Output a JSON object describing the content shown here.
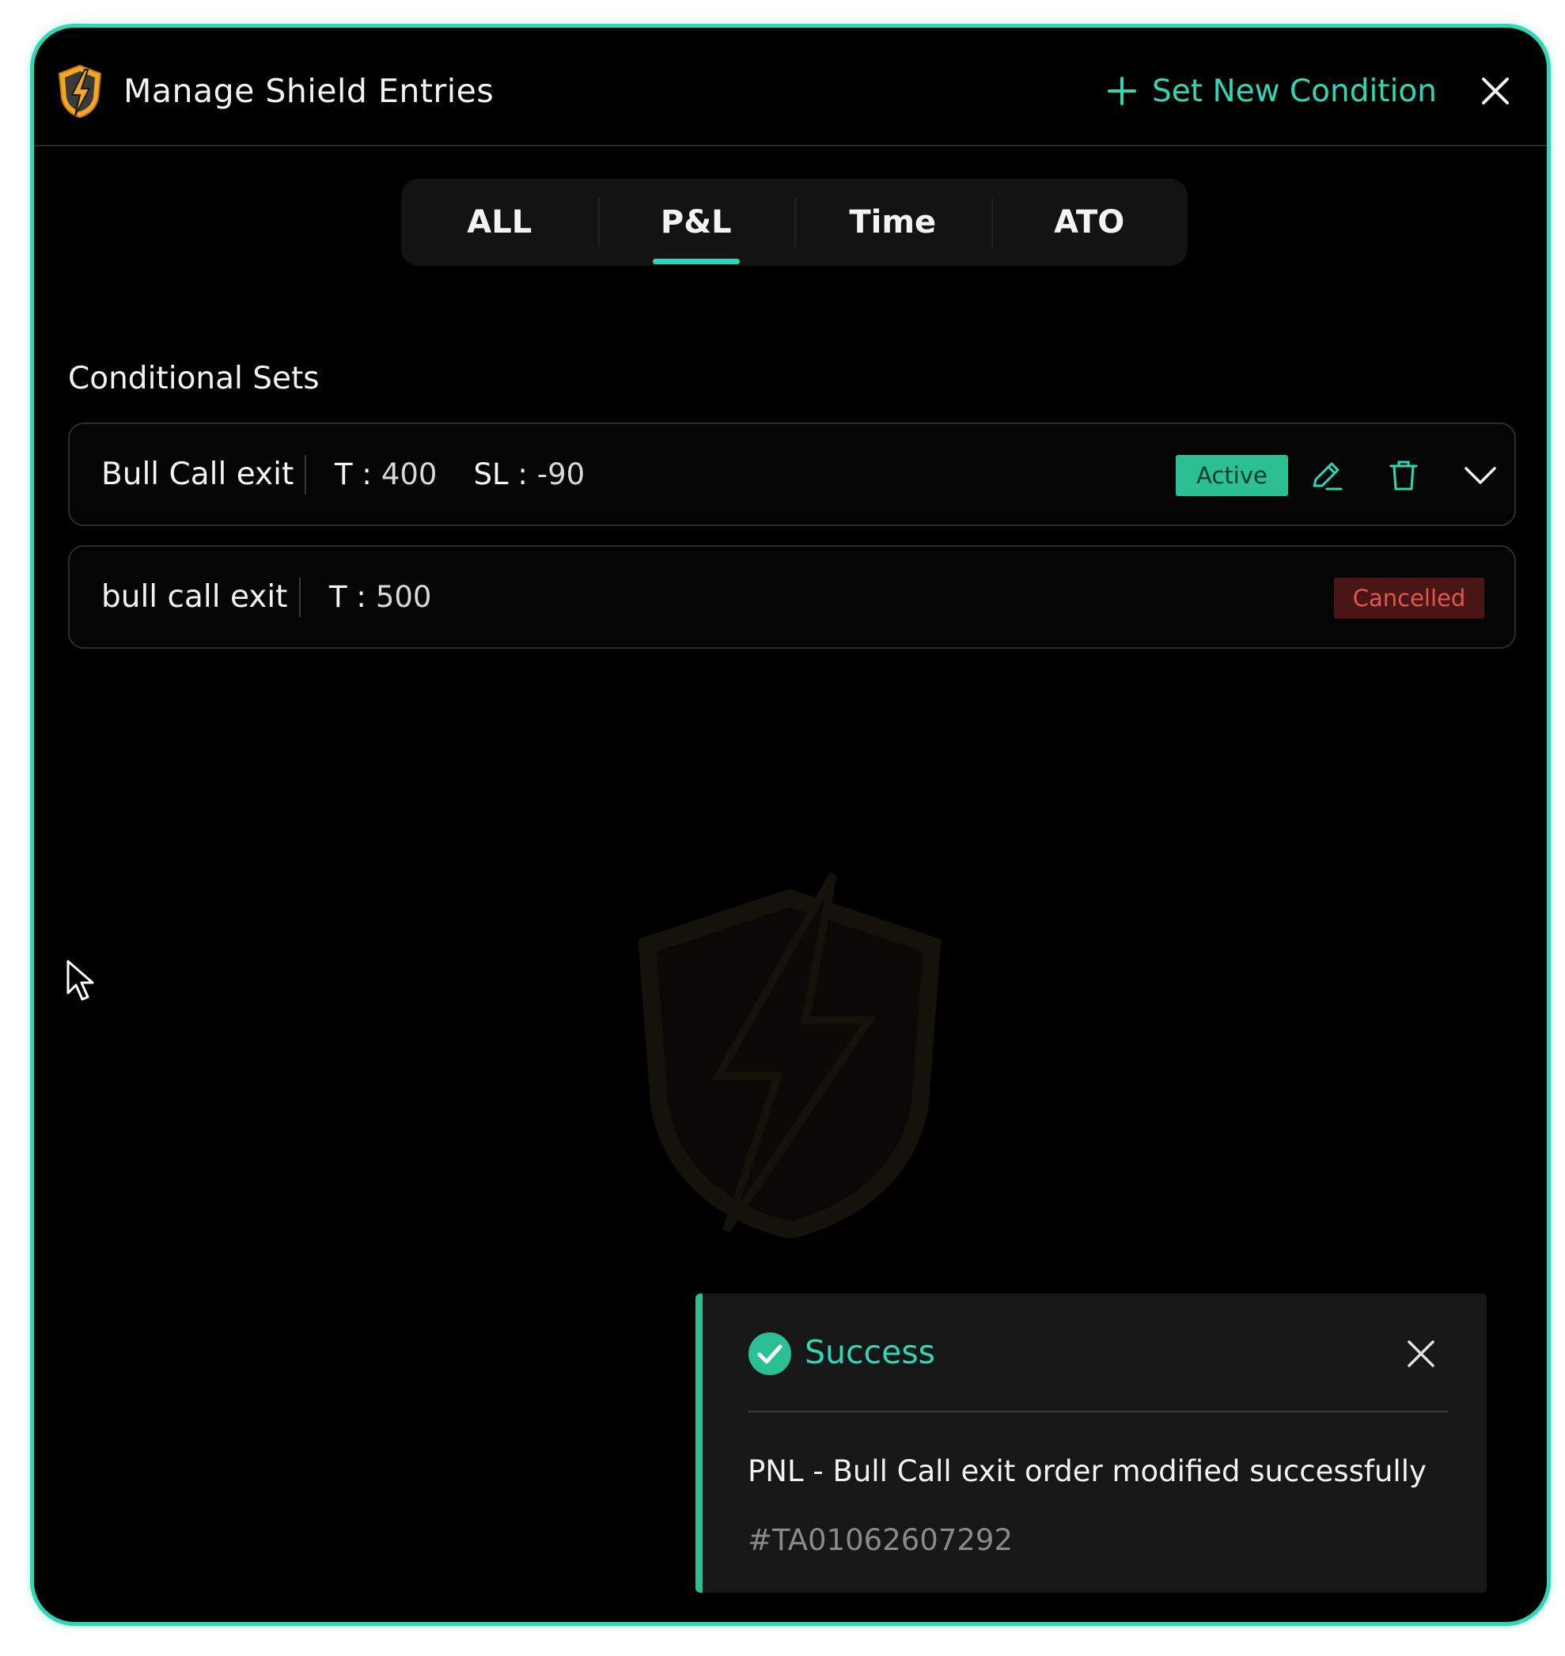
{
  "header": {
    "title": "Manage Shield Entries",
    "new_condition_label": "Set New Condition"
  },
  "tabs": [
    {
      "label": "ALL",
      "active": false
    },
    {
      "label": "P&L",
      "active": true
    },
    {
      "label": "Time",
      "active": false
    },
    {
      "label": "ATO",
      "active": false
    }
  ],
  "section": {
    "title": "Conditional Sets"
  },
  "conditions": [
    {
      "name": "Bull Call exit",
      "target_label": "T :",
      "target_value": "400",
      "stoploss_label": "SL :",
      "stoploss_value": "-90",
      "status": "Active"
    },
    {
      "name": "bull call exit",
      "target_label": "T :",
      "target_value": "500",
      "status": "Cancelled"
    }
  ],
  "toast": {
    "title": "Success",
    "message": "PNL - Bull Call exit order modified successfully",
    "order_id": "#TA01062607292"
  },
  "colors": {
    "accent": "#2fd8b4",
    "active_badge": "#2bbf93",
    "cancel_badge_bg": "#4a1515",
    "cancel_badge_text": "#e0584f",
    "background": "#000000"
  },
  "icons": {
    "logo": "shield-bolt-icon",
    "new_condition": "plus-icon",
    "close": "close-icon",
    "edit": "pencil-icon",
    "delete": "trash-icon",
    "expand": "chevron-down-icon",
    "success": "check-circle-icon",
    "watermark": "shield-bolt-icon",
    "cursor": "mouse-cursor-icon"
  }
}
